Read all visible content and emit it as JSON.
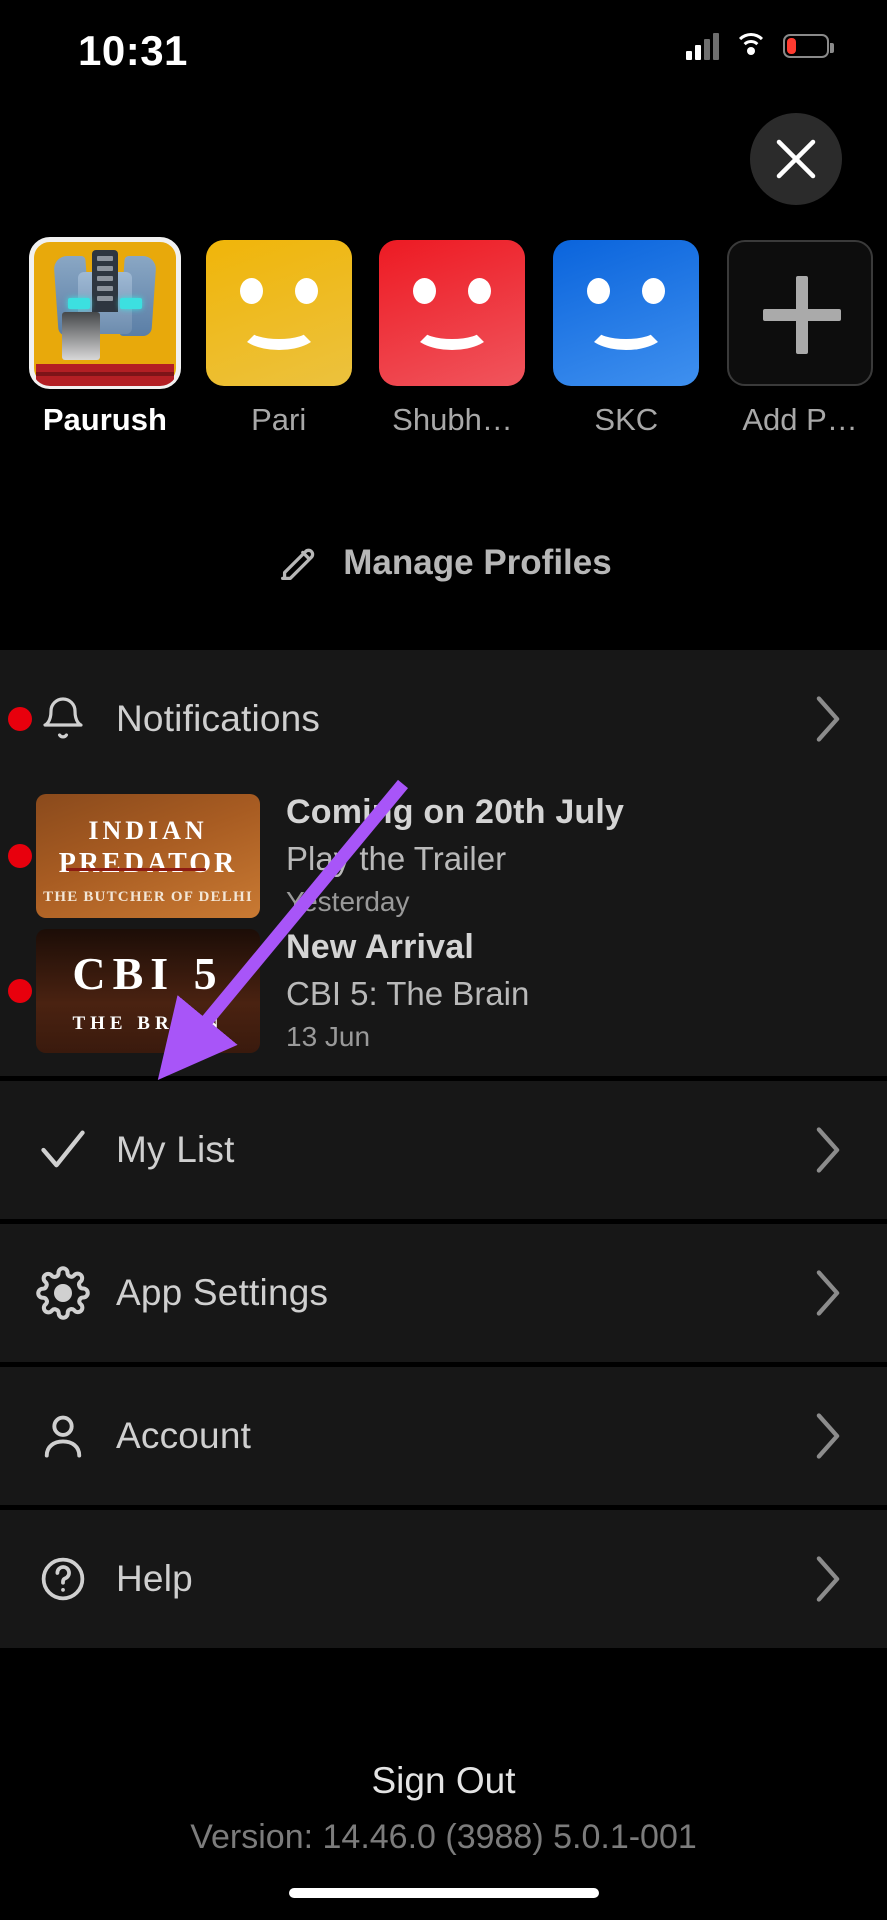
{
  "status_bar": {
    "time": "10:31",
    "cell_icon": "cellular-signal-icon",
    "wifi_icon": "wifi-icon",
    "battery_icon": "battery-low-icon",
    "battery_color": "#ff3b30"
  },
  "header": {
    "close_label": "close-icon"
  },
  "profiles": {
    "items": [
      {
        "name": "Paurush",
        "avatar": "optimus-prime-avatar",
        "selected": true,
        "color": "#e8a90b"
      },
      {
        "name": "Pari",
        "avatar": "smiley-avatar",
        "selected": false,
        "color": "#f0b509"
      },
      {
        "name": "Shubh…",
        "avatar": "smiley-avatar",
        "selected": false,
        "color": "#ed1a23"
      },
      {
        "name": "SKC",
        "avatar": "smiley-avatar",
        "selected": false,
        "color": "#0a64dc"
      },
      {
        "name": "Add P…",
        "avatar": "add-profile-avatar",
        "selected": false,
        "color": "#0d0d0d"
      }
    ],
    "manage_label": "Manage Profiles",
    "manage_icon": "pencil-icon"
  },
  "notifications": {
    "header_label": "Notifications",
    "header_icon": "bell-icon",
    "unread_dot_color": "#e8000d",
    "items": [
      {
        "title": "Coming on 20th July",
        "subtitle": "Play the Trailer",
        "date": "Yesterday",
        "unread": true,
        "thumb": {
          "kind": "indian-predator-poster",
          "line1": "INDIAN",
          "line2": "PREDATOR",
          "line3": "THE BUTCHER OF DELHI"
        }
      },
      {
        "title": "New Arrival",
        "subtitle": "CBI 5: The Brain",
        "date": "13 Jun",
        "unread": true,
        "thumb": {
          "kind": "cbi5-poster",
          "line1": "CBI 5",
          "line2": "THE BRAIN"
        }
      }
    ]
  },
  "menu": {
    "items": [
      {
        "label": "My List",
        "icon": "checkmark-icon"
      },
      {
        "label": "App Settings",
        "icon": "gear-icon"
      },
      {
        "label": "Account",
        "icon": "person-icon"
      },
      {
        "label": "Help",
        "icon": "question-circle-icon"
      }
    ]
  },
  "footer": {
    "sign_out_label": "Sign Out",
    "version_label": "Version: 14.46.0 (3988) 5.0.1-001"
  },
  "annotation": {
    "arrow_color": "#a855f8",
    "points_to": "App Settings"
  }
}
